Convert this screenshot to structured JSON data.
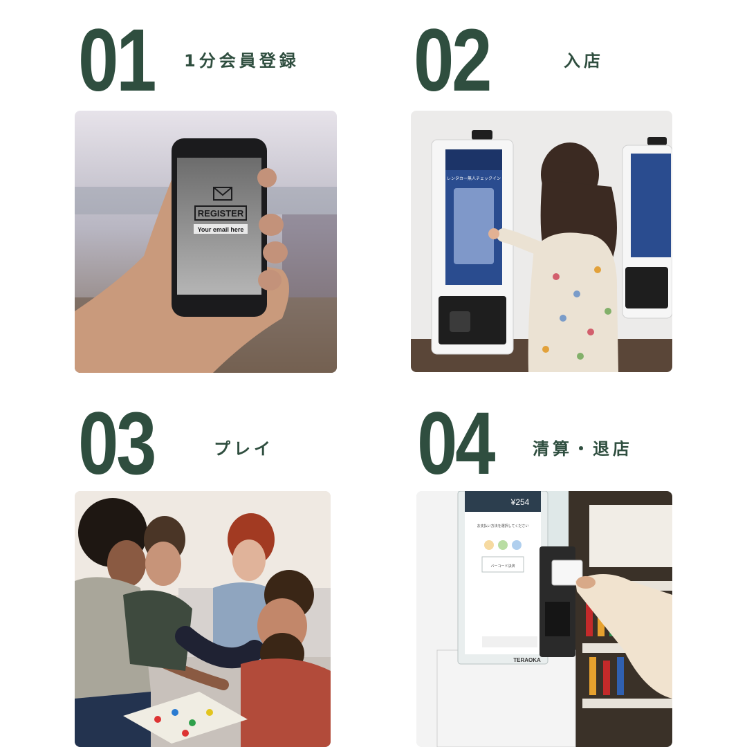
{
  "steps": [
    {
      "number": "01",
      "label": "1分会員登録"
    },
    {
      "number": "02",
      "label": "入店"
    },
    {
      "number": "03",
      "label": "プレイ"
    },
    {
      "number": "04",
      "label": "清算・退店"
    }
  ],
  "photo1": {
    "register_text": "REGISTER",
    "email_placeholder": "Your email here"
  },
  "photo2": {
    "kiosk_heading": "レンタカー無人チェックイン"
  },
  "photo4": {
    "price": "¥254",
    "prompt": "お支払い方法を選択してください",
    "barcode_btn": "バーコード決済",
    "brand": "TERAOKA"
  },
  "colors": {
    "accent": "#2f4e3f",
    "background": "#ffffff"
  }
}
